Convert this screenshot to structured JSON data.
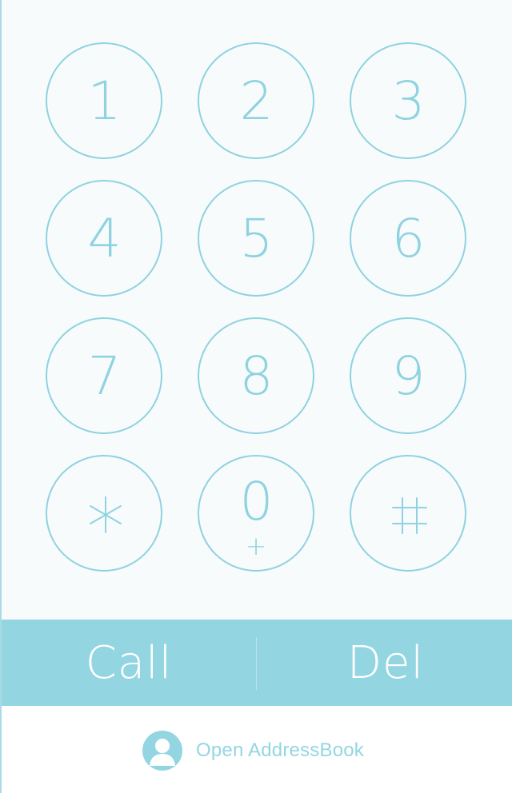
{
  "keypad": {
    "keys": [
      {
        "digit": "1",
        "name": "key-1"
      },
      {
        "digit": "2",
        "name": "key-2"
      },
      {
        "digit": "3",
        "name": "key-3"
      },
      {
        "digit": "4",
        "name": "key-4"
      },
      {
        "digit": "5",
        "name": "key-5"
      },
      {
        "digit": "6",
        "name": "key-6"
      },
      {
        "digit": "7",
        "name": "key-7"
      },
      {
        "digit": "8",
        "name": "key-8"
      },
      {
        "digit": "9",
        "name": "key-9"
      }
    ],
    "star_icon": "asterisk-icon",
    "zero_digit": "0",
    "zero_sub": "+",
    "hash_icon": "hash-icon"
  },
  "actions": {
    "call_label": "Call",
    "delete_label": "Del"
  },
  "footer": {
    "addressbook_label": "Open AddressBook",
    "addressbook_icon": "person-avatar-icon"
  },
  "colors": {
    "accent": "#8fd2e0",
    "bar": "#93d6e2",
    "background": "#f7fbfc",
    "button_text": "#ffffff"
  }
}
